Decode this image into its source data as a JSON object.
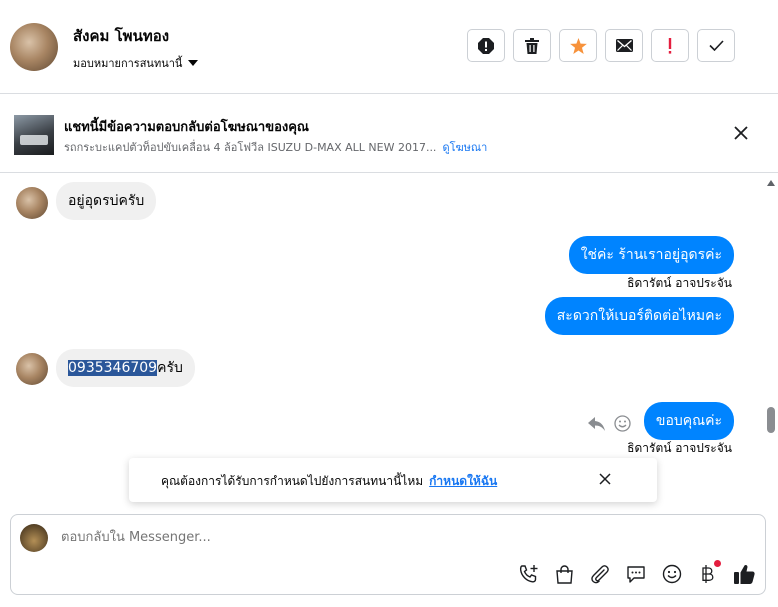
{
  "header": {
    "contact_name": "สังคม โพนทอง",
    "assign_label": "มอบหมายการสนทนานี้",
    "toolbar": [
      "spam-alert",
      "delete",
      "star",
      "mark-unread",
      "important",
      "done"
    ]
  },
  "ad": {
    "title": "แชทนี้มีข้อความตอบกลับต่อโฆษณาของคุณ",
    "subtitle": "รถกระบะแคปตัวท็อปขับเคลื่อน 4 ล้อโฟวีล ISUZU D-MAX ALL NEW 2017...",
    "link": "ดูโฆษณา"
  },
  "messages": [
    {
      "dir": "in",
      "text": "อยู่อุดรบ่ครับ"
    },
    {
      "dir": "out",
      "text": "ใช่ค่ะ ร้านเราอยู่อุดรค่ะ",
      "sender": "ธิดารัตน์ อาจประจัน"
    },
    {
      "dir": "out",
      "text": "สะดวกให้เบอร์ติดต่อไหมคะ"
    },
    {
      "dir": "in",
      "highlight": "0935346709",
      "text": "ครับ"
    },
    {
      "dir": "out",
      "text": "ขอบคุณค่ะ",
      "sender": "ธิดารัตน์ อาจประจัน"
    }
  ],
  "toast": {
    "text": "คุณต้องการได้รับการกำหนดไปยังการสนทนานี้ไหม",
    "link": "กำหนดให้ฉัน"
  },
  "composer": {
    "placeholder": "ตอบกลับใน Messenger..."
  },
  "colors": {
    "accent": "#0084ff",
    "link": "#1877f2",
    "star": "#f7923b",
    "important": "#e41e3f"
  }
}
